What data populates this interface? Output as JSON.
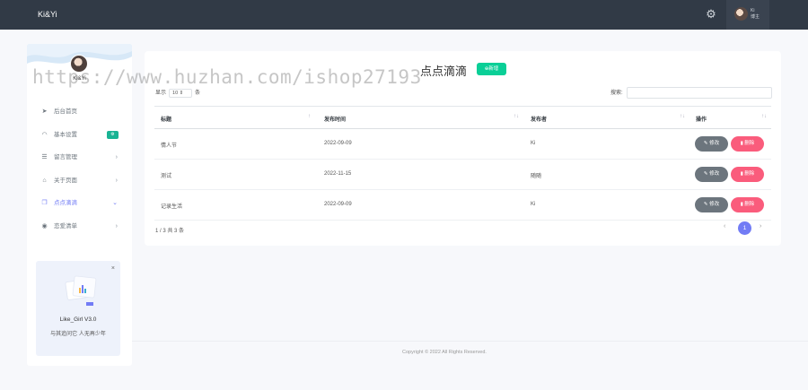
{
  "app": {
    "brand": "Ki&Yi"
  },
  "topbar": {
    "user_name": "Ki",
    "user_role": "博主"
  },
  "sidebar": {
    "profile_name": "Ki&Yi",
    "items": [
      {
        "label": "后台首页",
        "icon": "send-icon"
      },
      {
        "label": "基本设置",
        "icon": "gauge-icon",
        "badge": "⚙"
      },
      {
        "label": "留言管理",
        "icon": "list-icon",
        "chevron": "›"
      },
      {
        "label": "关于页面",
        "icon": "tag-icon",
        "chevron": "›"
      },
      {
        "label": "点点滴滴",
        "icon": "copy-icon",
        "chevron": "⌄",
        "active": true
      },
      {
        "label": "恋爱清单",
        "icon": "location-icon",
        "chevron": "›"
      }
    ],
    "promo": {
      "title": "Like_Girl V3.0",
      "subtitle": "与其追问它 人无再少年"
    }
  },
  "main": {
    "title": "点点滴滴",
    "add_button": "新增",
    "length_prefix": "显示",
    "length_value": "10",
    "length_suffix": "条",
    "search_label": "搜索:",
    "columns": [
      "标题",
      "发布时间",
      "发布者",
      "操作"
    ],
    "rows": [
      {
        "title": "情人节",
        "date": "2022-09-09",
        "author": "Ki"
      },
      {
        "title": "测试",
        "date": "2022-11-15",
        "author": "随随"
      },
      {
        "title": "记录生活",
        "date": "2022-09-09",
        "author": "Ki"
      }
    ],
    "edit_label": "修改",
    "delete_label": "删除",
    "info": "1 / 3 共 3 条",
    "current_page": "1",
    "prev": "‹",
    "next": "›"
  },
  "footer": {
    "text": "Copyright © 2022 All Rights Reserved."
  },
  "watermark": "https://www.huzhan.com/ishop27193",
  "colors": {
    "primary": "#727cf5",
    "success": "#0acf97",
    "danger": "#fa5c7c",
    "topbar": "#313a46"
  }
}
